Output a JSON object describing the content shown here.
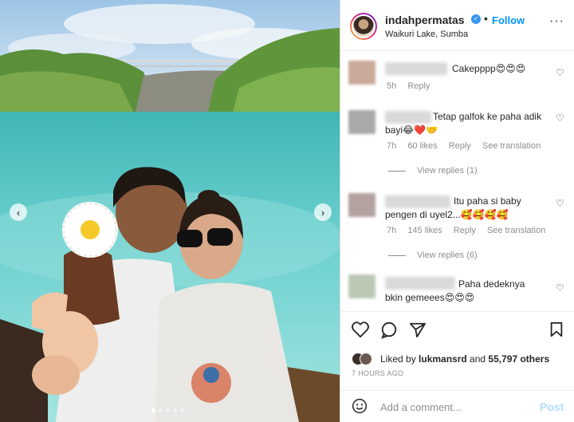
{
  "post": {
    "username": "indahpermatas",
    "location": "Waikuri Lake, Sumba",
    "follow_label": "Follow",
    "bullet": "•",
    "more": "···"
  },
  "photo": {
    "nav_left": "‹",
    "nav_right": "›",
    "dots_total": 5,
    "dots_active": 0
  },
  "comments": [
    {
      "text": "Cakepppp😍😍😍",
      "meta": [
        "5h",
        "Reply"
      ]
    },
    {
      "text": "Tetap galfok ke paha adik bayi😂❤️🤝",
      "meta": [
        "7h",
        "60 likes",
        "Reply",
        "See translation"
      ],
      "replies": "View replies (1)"
    },
    {
      "text": "Itu paha si baby pengen di uyel2...🥰🥰🥰🥰",
      "meta": [
        "7h",
        "145 likes",
        "Reply",
        "See translation"
      ],
      "replies": "View replies (6)"
    },
    {
      "text": "Paha dedeknya bkin gemeees😍😍😍",
      "meta": []
    }
  ],
  "actions": {
    "liked_prefix": "Liked by ",
    "liked_user": "lukmansrd",
    "liked_mid": " and ",
    "liked_count": "55,797 others",
    "time_ago": "7 HOURS AGO",
    "comment_placeholder": "Add a comment...",
    "post_label": "Post"
  },
  "colors": {
    "accent": "#0095f6",
    "post_disabled": "#b2dffc",
    "muted": "#8e8e8e"
  },
  "icons": [
    "heart-icon",
    "comment-icon",
    "share-icon",
    "bookmark-icon",
    "smiley-icon",
    "verified-icon",
    "more-icon"
  ]
}
